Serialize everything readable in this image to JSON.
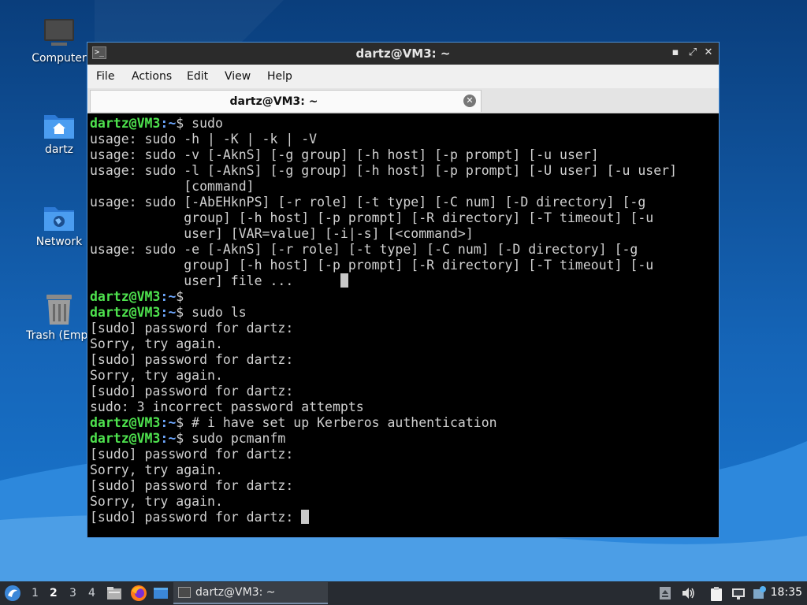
{
  "desktop": {
    "icons": [
      {
        "label": "Computer",
        "icon": "computer-icon"
      },
      {
        "label": "dartz",
        "icon": "home-folder-icon"
      },
      {
        "label": "Network",
        "icon": "network-folder-icon"
      },
      {
        "label": "Trash (Empt",
        "icon": "trash-icon"
      }
    ]
  },
  "window": {
    "title": "dartz@VM3: ~",
    "buttons": {
      "minimize": "▪",
      "maximize": "⤢",
      "close": "✕"
    },
    "menu": [
      "File",
      "Actions",
      "Edit",
      "View",
      "Help"
    ],
    "tab_label": "dartz@VM3: ~",
    "tab_close": "✕"
  },
  "terminal": {
    "prompt_user": "dartz@VM3",
    "prompt_path": ":~",
    "lines": [
      {
        "type": "prompt",
        "cmd": "$ sudo"
      },
      {
        "type": "out",
        "text": "usage: sudo -h | -K | -k | -V"
      },
      {
        "type": "out",
        "text": "usage: sudo -v [-AknS] [-g group] [-h host] [-p prompt] [-u user]"
      },
      {
        "type": "out",
        "text": "usage: sudo -l [-AknS] [-g group] [-h host] [-p prompt] [-U user] [-u user]"
      },
      {
        "type": "out",
        "text": "            [command]"
      },
      {
        "type": "out",
        "text": "usage: sudo [-AbEHknPS] [-r role] [-t type] [-C num] [-D directory] [-g"
      },
      {
        "type": "out",
        "text": "            group] [-h host] [-p prompt] [-R directory] [-T timeout] [-u"
      },
      {
        "type": "out",
        "text": "            user] [VAR=value] [-i|-s] [<command>]"
      },
      {
        "type": "out",
        "text": "usage: sudo -e [-AknS] [-r role] [-t type] [-C num] [-D directory] [-g"
      },
      {
        "type": "out",
        "text": "            group] [-h host] [-p prompt] [-R directory] [-T timeout] [-u"
      },
      {
        "type": "out",
        "text": "            user] file ...      ",
        "cursor": true
      },
      {
        "type": "prompt",
        "cmd": "$"
      },
      {
        "type": "prompt",
        "cmd": "$ sudo ls"
      },
      {
        "type": "out",
        "text": "[sudo] password for dartz:"
      },
      {
        "type": "out",
        "text": "Sorry, try again."
      },
      {
        "type": "out",
        "text": "[sudo] password for dartz:"
      },
      {
        "type": "out",
        "text": "Sorry, try again."
      },
      {
        "type": "out",
        "text": "[sudo] password for dartz:"
      },
      {
        "type": "out",
        "text": "sudo: 3 incorrect password attempts"
      },
      {
        "type": "prompt",
        "cmd": "$ # i have set up Kerberos authentication"
      },
      {
        "type": "prompt",
        "cmd": "$ sudo pcmanfm"
      },
      {
        "type": "out",
        "text": "[sudo] password for dartz:"
      },
      {
        "type": "out",
        "text": "Sorry, try again."
      },
      {
        "type": "out",
        "text": "[sudo] password for dartz:"
      },
      {
        "type": "out",
        "text": "Sorry, try again."
      },
      {
        "type": "out",
        "text": "[sudo] password for dartz: ",
        "cursor": true
      }
    ],
    "colors": {
      "prompt_user": "#4ee24e",
      "prompt_path": "#6ea8ff",
      "text": "#d0d0d0",
      "background": "#000000"
    }
  },
  "taskbar": {
    "start_icon": "lubuntu-start-icon",
    "workspaces": [
      "1",
      "2",
      "3",
      "4"
    ],
    "active_workspace": "2",
    "launchers": [
      "file-manager-icon",
      "firefox-icon",
      "show-desktop-icon"
    ],
    "task_label": "dartz@VM3: ~",
    "tray": [
      "eject-icon",
      "volume-icon",
      "clipboard-icon",
      "network-icon",
      "update-notifier-icon"
    ],
    "clock": "18:35"
  }
}
